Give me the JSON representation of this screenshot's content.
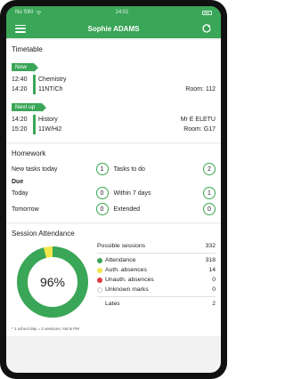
{
  "status_bar": {
    "carrier": "No SIM",
    "time": "14:01"
  },
  "header": {
    "title": "Sophie ADAMS"
  },
  "timetable": {
    "title": "Timetable",
    "now_label": "Now",
    "now": {
      "start": "12:40",
      "end": "14:20",
      "subject": "Chemistry",
      "group": "11NT/Ch",
      "teacher": "",
      "room": "Room: 112"
    },
    "next_label": "Next up",
    "next": {
      "start": "14:20",
      "end": "15:20",
      "subject": "History",
      "group": "11W/Hi2",
      "teacher": "Mr E ELETU",
      "room": "Room: G17"
    }
  },
  "homework": {
    "title": "Homework",
    "new_tasks_label": "New tasks today",
    "new_tasks_count": "1",
    "tasks_to_do_label": "Tasks to do",
    "tasks_to_do_count": "2",
    "due_label": "Due",
    "today_label": "Today",
    "today_count": "0",
    "within7_label": "Within 7 days",
    "within7_count": "1",
    "tomorrow_label": "Tomorrow",
    "tomorrow_count": "0",
    "extended_label": "Extended",
    "extended_count": "0"
  },
  "attendance": {
    "title": "Session Attendance",
    "percent": "96%",
    "percent_value": 96,
    "possible_label": "Possible sessions",
    "possible_count": "332",
    "attendance_label": "Attendance",
    "attendance_count": "318",
    "auth_label": "Auth. absences",
    "auth_count": "14",
    "unauth_label": "Unauth. absences",
    "unauth_count": "0",
    "unknown_label": "Unknown marks",
    "unknown_count": "0",
    "lates_label": "Lates",
    "lates_count": "2",
    "footnote": "* 1 school day = 2 sessions: AM & PM",
    "colors": {
      "attendance": "#3aa657",
      "auth": "#f2e64a",
      "unauth": "#e0383e",
      "unknown": "#ffffff"
    }
  },
  "colors": {
    "brand": "#3aa657"
  },
  "icons": {
    "menu": "hamburger-icon",
    "refresh": "refresh-icon"
  }
}
